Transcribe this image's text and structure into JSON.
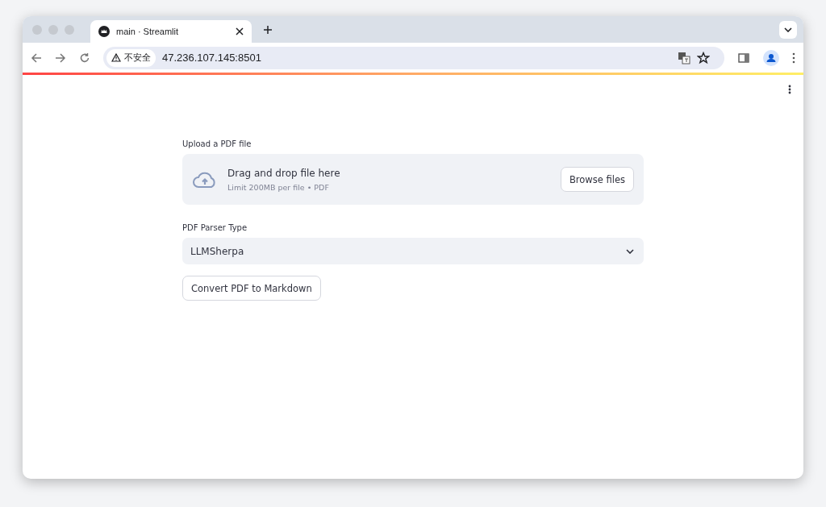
{
  "window": {
    "tab": {
      "title": "main · Streamlit"
    },
    "address": {
      "security_label": "不安全",
      "url": "47.236.107.145:8501"
    }
  },
  "app": {
    "uploader": {
      "label": "Upload a PDF file",
      "title": "Drag and drop file here",
      "hint": "Limit 200MB per file • PDF",
      "button": "Browse files"
    },
    "select": {
      "label": "PDF Parser Type",
      "value": "LLMSherpa"
    },
    "button": "Convert PDF to Markdown"
  }
}
